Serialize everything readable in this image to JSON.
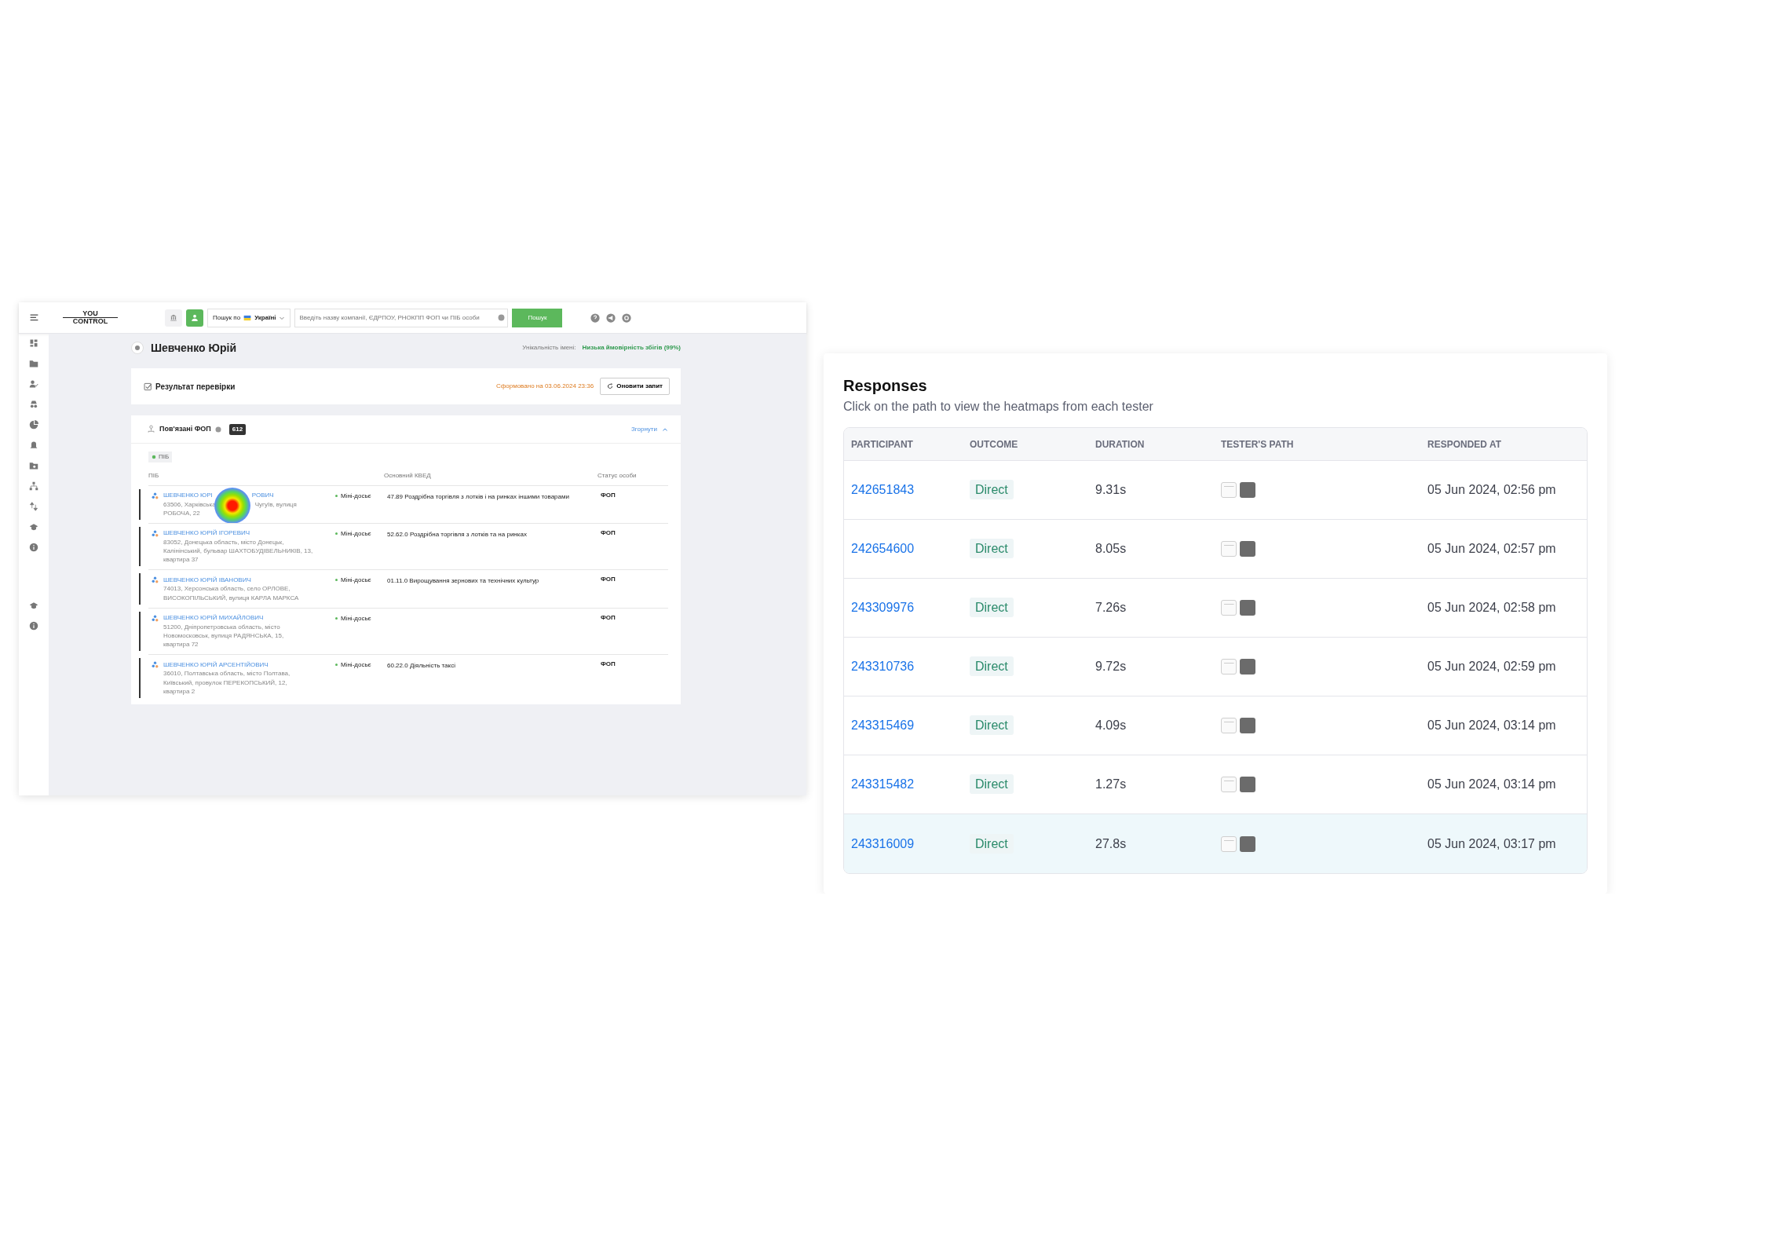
{
  "app": {
    "logo": [
      "YOU",
      "CONTROL"
    ],
    "search": {
      "scope_label": "Пошук по",
      "country": "Україні",
      "placeholder": "Введіть назву компанії, ЄДРПОУ, РНОКПП ФОП чи ПІБ особи",
      "button": "Пошук"
    },
    "person": {
      "name": "Шевченко Юрій",
      "uniqueness_label": "Унікальність імені:",
      "uniqueness_value": "Низька ймовірність збігів (99%)"
    },
    "result": {
      "title": "Результат перевірки",
      "generated": "Сформовано на 03.06.2024 23:36",
      "refresh": "Оновити запит"
    },
    "related": {
      "title": "Пов'язані ФОП",
      "count": "612",
      "collapse": "Згорнути",
      "filter": "ПІБ",
      "columns": [
        "ПІБ",
        "Основний КВЕД",
        "Статус особи"
      ],
      "rows": [
        {
          "name": [
            "ШЕВЧЕНКО ЮРІ",
            "РОВИЧ"
          ],
          "address": [
            [
              "63506, Харківська",
              "Чугуїв, вулиця"
            ],
            [
              "РОБОЧА, 22"
            ]
          ],
          "dossier": "Міні-досьє",
          "kved": "47.89 Роздрібна торгівля з лотків і на ринках іншими товарами",
          "status": "ФОП",
          "heat": true
        },
        {
          "name": [
            "ШЕВЧЕНКО ЮРІЙ ІГОРЕВИЧ"
          ],
          "address": [
            [
              "83052, Донецька область, місто Донецьк,"
            ],
            [
              "Калінінський, бульвар ШАХТОБУДІВЕЛЬНИКІВ, 13,"
            ],
            [
              "квартира 37"
            ]
          ],
          "dossier": "Міні-досьє",
          "kved": "52.62.0 Роздрібна торгівля з лотків та на ринках",
          "status": "ФОП",
          "heat": false
        },
        {
          "name": [
            "ШЕВЧЕНКО ЮРІЙ ІВАНОВИЧ"
          ],
          "address": [
            [
              "74013, Херсонська область, село ОРЛОВЕ,"
            ],
            [
              "ВИСОКОПІЛЬСЬКИЙ, вулиця КАРЛА МАРКСА"
            ]
          ],
          "dossier": "Міні-досьє",
          "kved": "01.11.0 Вирощування зернових та технічних культур",
          "status": "ФОП",
          "heat": false
        },
        {
          "name": [
            "ШЕВЧЕНКО ЮРІЙ МИХАЙЛОВИЧ"
          ],
          "address": [
            [
              "51200, Дніпропетровська область, місто"
            ],
            [
              "Новомосковськ, вулиця РАДЯНСЬКА, 15,"
            ],
            [
              "квартира 72"
            ]
          ],
          "dossier": "Міні-досьє",
          "status": "ФОП",
          "heat": false
        },
        {
          "name": [
            "ШЕВЧЕНКО ЮРІЙ АРСЕНТІЙОВИЧ"
          ],
          "address": [
            [
              "36010, Полтавська область, місто Полтава,"
            ],
            [
              "Київський, провулок ПЕРЕКОПСЬКИЙ, 12,"
            ],
            [
              "квартира 2"
            ]
          ],
          "dossier": "Міні-досьє",
          "kved": "60.22.0 Діяльність таксі",
          "status": "ФОП",
          "heat": false
        }
      ]
    }
  },
  "responses": {
    "title": "Responses",
    "subtitle": "Click on the path to view the heatmaps from each tester",
    "columns": [
      "PARTICIPANT",
      "OUTCOME",
      "DURATION",
      "TESTER'S PATH",
      "RESPONDED AT"
    ],
    "rows": [
      {
        "participant": "242651843",
        "outcome": "Direct",
        "duration": "9.31s",
        "responded": "05 Jun 2024, 02:56 pm",
        "selected": false
      },
      {
        "participant": "242654600",
        "outcome": "Direct",
        "duration": "8.05s",
        "responded": "05 Jun 2024, 02:57 pm",
        "selected": false
      },
      {
        "participant": "243309976",
        "outcome": "Direct",
        "duration": "7.26s",
        "responded": "05 Jun 2024, 02:58 pm",
        "selected": false
      },
      {
        "participant": "243310736",
        "outcome": "Direct",
        "duration": "9.72s",
        "responded": "05 Jun 2024, 02:59 pm",
        "selected": false
      },
      {
        "participant": "243315469",
        "outcome": "Direct",
        "duration": "4.09s",
        "responded": "05 Jun 2024, 03:14 pm",
        "selected": false
      },
      {
        "participant": "243315482",
        "outcome": "Direct",
        "duration": "1.27s",
        "responded": "05 Jun 2024, 03:14 pm",
        "selected": false
      },
      {
        "participant": "243316009",
        "outcome": "Direct",
        "duration": "27.8s",
        "responded": "05 Jun 2024, 03:17 pm",
        "selected": true
      }
    ]
  }
}
